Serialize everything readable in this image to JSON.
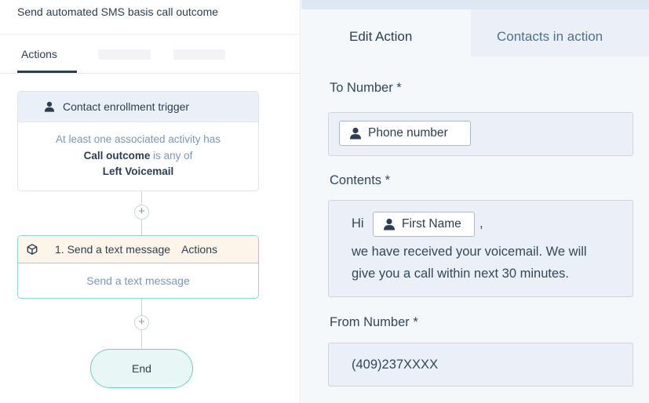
{
  "workflow": {
    "title": "Send automated SMS basis call outcome",
    "tabs": [
      {
        "label": "Actions"
      }
    ]
  },
  "trigger": {
    "title": "Contact enrollment trigger",
    "line1": "At least one associated activity has",
    "property": "Call outcome",
    "operator": " is any of",
    "value": "Left Voicemail"
  },
  "action": {
    "title": "1. Send a text message",
    "link": "Actions",
    "body": "Send a text message"
  },
  "add_button": {
    "glyph": "+"
  },
  "end": {
    "label": "End"
  },
  "editor": {
    "tabs": [
      {
        "label": "Edit Action",
        "active": true
      },
      {
        "label": "Contacts in action",
        "active": false
      }
    ],
    "to_number": {
      "label": "To Number *",
      "token": "Phone number"
    },
    "contents": {
      "label": "Contents *",
      "greeting": "Hi",
      "token": "First Name",
      "after_token": ",",
      "line2": "we have received your voicemail. We will",
      "line3": "give you a call within next 30 minutes."
    },
    "from_number": {
      "label": "From Number *",
      "value": "(409)237XXXX"
    }
  },
  "colors": {
    "action_border": "#8fd6d0",
    "end_fill": "#e8f7f5",
    "trigger_header": "#eaf0f6",
    "field_fill": "#eaf0f6"
  },
  "icons": {
    "person": "person-icon",
    "box": "box-icon"
  }
}
